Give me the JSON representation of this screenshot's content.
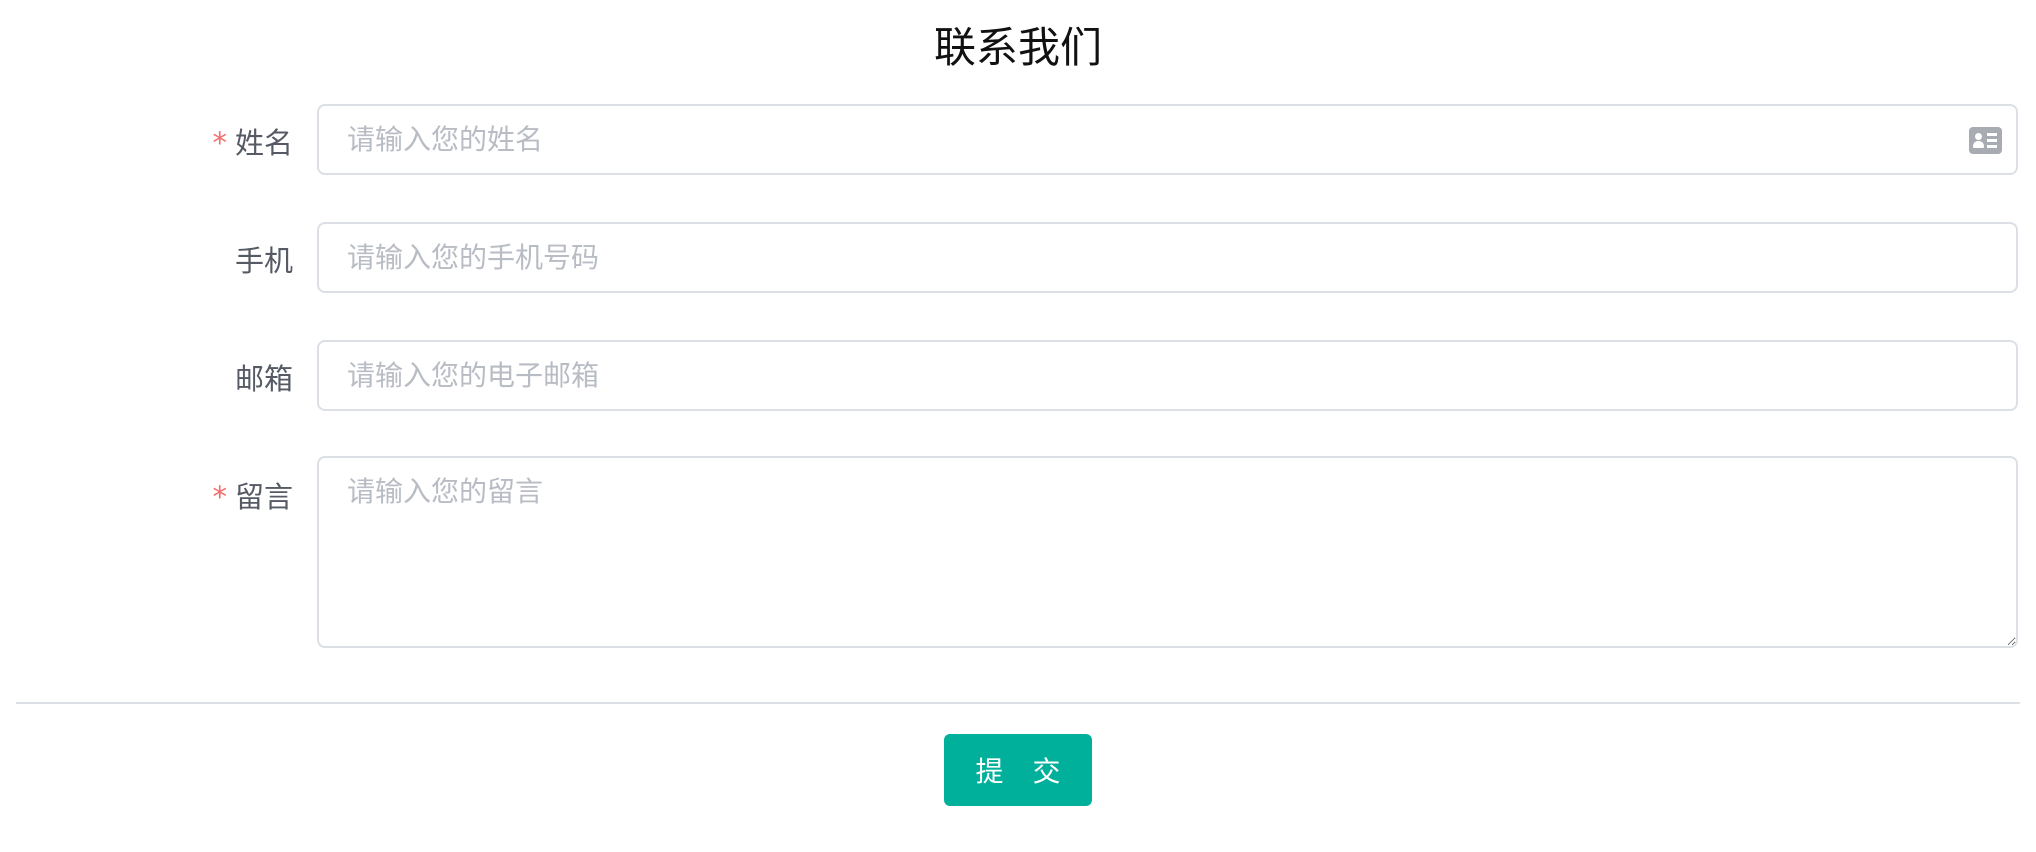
{
  "title": "联系我们",
  "form": {
    "name": {
      "label": "姓名",
      "required_mark": "*",
      "placeholder": "请输入您的姓名",
      "icon": "contact-card-icon"
    },
    "phone": {
      "label": "手机",
      "placeholder": "请输入您的手机号码"
    },
    "email": {
      "label": "邮箱",
      "placeholder": "请输入您的电子邮箱"
    },
    "message": {
      "label": "留言",
      "required_mark": "*",
      "placeholder": "请输入您的留言"
    }
  },
  "submit_label": "提 交",
  "colors": {
    "accent": "#00b09b",
    "required": "#f56c6c",
    "border": "#dcdfe6",
    "placeholder": "#b8bcc4",
    "label": "#555a64"
  }
}
